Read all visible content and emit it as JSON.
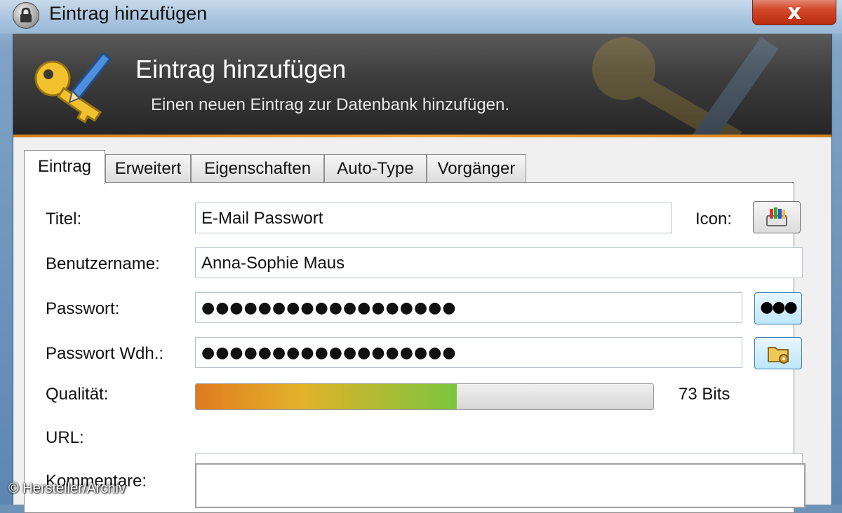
{
  "window": {
    "title": "Eintrag hinzufügen",
    "close_label": "x"
  },
  "banner": {
    "title": "Eintrag hinzufügen",
    "subtitle": "Einen neuen Eintrag zur Datenbank hinzufügen.",
    "icon": "key-pen-icon"
  },
  "tabs": [
    {
      "label": "Eintrag",
      "active": true
    },
    {
      "label": "Erweitert",
      "active": false
    },
    {
      "label": "Eigenschaften",
      "active": false
    },
    {
      "label": "Auto-Type",
      "active": false
    },
    {
      "label": "Vorgänger",
      "active": false
    }
  ],
  "form": {
    "title_label": "Titel:",
    "title_value": "E-Mail Passwort",
    "icon_label": "Icon:",
    "username_label": "Benutzername:",
    "username_value": "Anna-Sophie Maus",
    "password_label": "Passwort:",
    "password_value": "●●●●●●●●●●●●●●●●●●",
    "password_repeat_label": "Passwort Wdh.:",
    "password_repeat_value": "●●●●●●●●●●●●●●●●●●",
    "show_password_button": "●●●",
    "quality_label": "Qualität:",
    "quality_value": "73 Bits",
    "quality_fraction": 0.57,
    "url_label": "URL:",
    "url_value": "",
    "comments_label": "Kommentare:"
  },
  "credit": "© Hersteller/Archiv",
  "colors": {
    "banner_accent": "#f3a23a",
    "close_button": "#d34a2a",
    "quality_start": "#e07a1f",
    "quality_end": "#7cc53e"
  }
}
